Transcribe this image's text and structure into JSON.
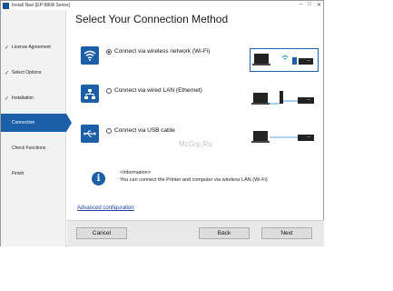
{
  "window": {
    "title": "Install Navi [EP-880A Series]",
    "controls": [
      "–",
      "□",
      "✕"
    ]
  },
  "sidebar": {
    "items": [
      {
        "label": "License Agreement",
        "done": true,
        "active": false
      },
      {
        "label": "Select Options",
        "done": true,
        "active": false
      },
      {
        "label": "Installation",
        "done": true,
        "active": false
      },
      {
        "label": "Connection",
        "done": false,
        "active": true
      },
      {
        "label": "Check Functions",
        "done": false,
        "active": false
      },
      {
        "label": "Finish",
        "done": false,
        "active": false
      }
    ]
  },
  "main": {
    "heading": "Select Your Connection Method",
    "options": [
      {
        "label": "Connect via wireless network (Wi-Fi)",
        "selected": true,
        "icon": "wifi-icon"
      },
      {
        "label": "Connect via wired LAN (Ethernet)",
        "selected": false,
        "icon": "lan-icon"
      },
      {
        "label": "Connect via USB cable",
        "selected": false,
        "icon": "usb-icon"
      }
    ],
    "info": {
      "title": "<Information>",
      "text": "You can connect the Printer and computer via wireless LAN (Wi-Fi)"
    },
    "advanced_link": "Advanced configuration"
  },
  "footer": {
    "cancel_label": "Cancel",
    "back_label": "Back",
    "next_label": "Next"
  },
  "watermark": "McGrp.Ru",
  "colors": {
    "accent": "#1a5fa8",
    "sidebar_bg": "#f2f2f2",
    "footer_bg": "#e9e9e9",
    "link": "#1a3fa8"
  }
}
